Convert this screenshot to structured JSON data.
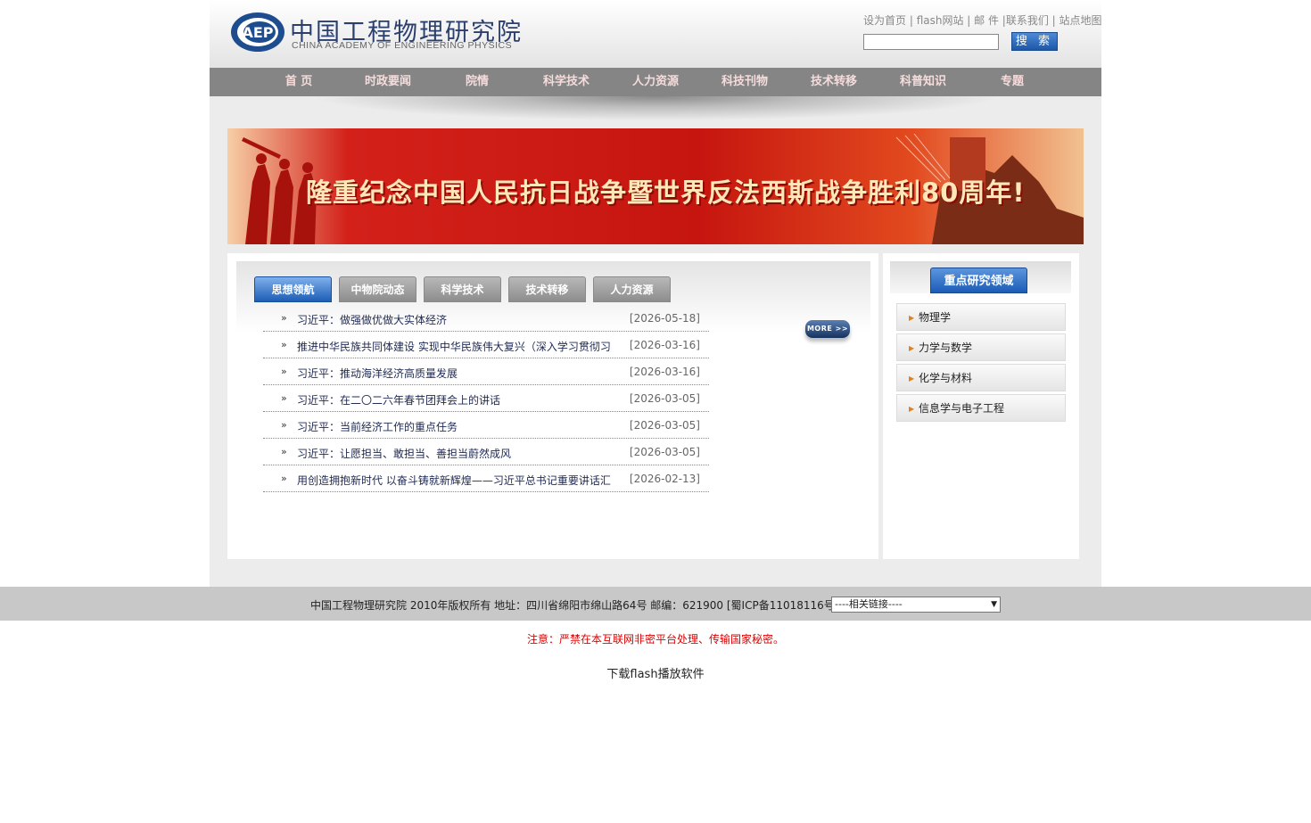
{
  "header": {
    "logo_cn": "中国工程物理研究院",
    "logo_en": "CHINA ACADEMY OF ENGINEERING PHYSICS",
    "logo_mark_text": "AEP",
    "top_links": [
      "设为首页",
      "flash网站",
      "邮 件",
      "联系我们",
      "站点地图"
    ],
    "search_button": "搜 索",
    "search_value": ""
  },
  "nav": [
    "首 页",
    "时政要闻",
    "院情",
    "科学技术",
    "人力资源",
    "科技刊物",
    "技术转移",
    "科普知识",
    "专题"
  ],
  "banner": {
    "title": "隆重纪念中国人民抗日战争暨世界反法西斯战争胜利80周年!"
  },
  "tabs": [
    {
      "label": "思想领航",
      "active": true
    },
    {
      "label": "中物院动态",
      "active": false
    },
    {
      "label": "科学技术",
      "active": false
    },
    {
      "label": "技术转移",
      "active": false
    },
    {
      "label": "人力资源",
      "active": false
    }
  ],
  "news": [
    {
      "title": "习近平：做强做优做大实体经济",
      "date": "[2026-05-18]"
    },
    {
      "title": "推进中华民族共同体建设 实现中华民族伟大复兴（深入学习贯彻习",
      "date": "[2026-03-16]"
    },
    {
      "title": "习近平：推动海洋经济高质量发展",
      "date": "[2026-03-16]"
    },
    {
      "title": "习近平：在二〇二六年春节团拜会上的讲话",
      "date": "[2026-03-05]"
    },
    {
      "title": "习近平：当前经济工作的重点任务",
      "date": "[2026-03-05]"
    },
    {
      "title": "习近平：让愿担当、敢担当、善担当蔚然成风",
      "date": "[2026-03-05]"
    },
    {
      "title": "用创造拥抱新时代 以奋斗铸就新辉煌——习近平总书记重要讲话汇",
      "date": "[2026-02-13]"
    }
  ],
  "news_bullet": "»",
  "more_label": "MORE >>",
  "side": {
    "title": "重点研究领域",
    "items": [
      "物理学",
      "力学与数学",
      "化学与材料",
      "信息学与电子工程"
    ]
  },
  "footer": {
    "text": "中国工程物理研究院 2010年版权所有 地址：四川省绵阳市绵山路64号 邮编：621900 [蜀ICP备11018116号-1]",
    "select_label": "----相关链接----",
    "notice": "注意：严禁在本互联网非密平台处理、传输国家秘密。",
    "flash_link": "下载flash播放软件"
  },
  "colors": {
    "nav_bg": "#858585",
    "nav_text": "#f6dcdc",
    "tab_active": "#1c5db5",
    "notice": "#e00000",
    "banner_red": "#c6150f"
  }
}
